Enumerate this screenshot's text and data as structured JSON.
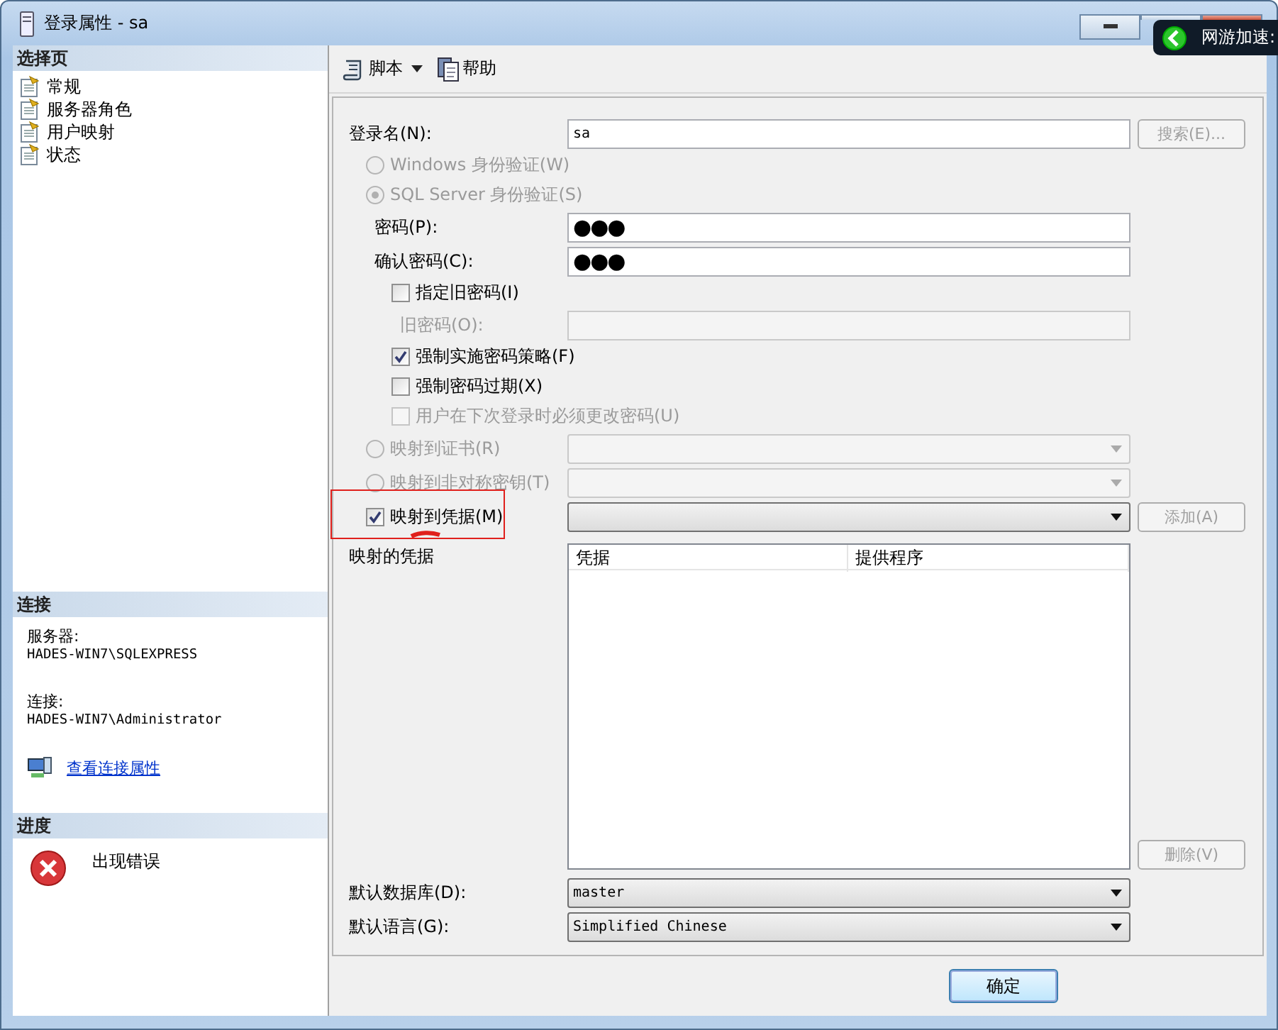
{
  "window": {
    "title": "登录属性 - sa"
  },
  "overlay": {
    "label": "网游加速:"
  },
  "sidebar": {
    "header": "选择页",
    "items": [
      {
        "label": "常规"
      },
      {
        "label": "服务器角色"
      },
      {
        "label": "用户映射"
      },
      {
        "label": "状态"
      }
    ]
  },
  "connection": {
    "header": "连接",
    "server_label": "服务器:",
    "server": "HADES-WIN7\\SQLEXPRESS",
    "user_label": "连接:",
    "user": "HADES-WIN7\\Administrator",
    "link": "查看连接属性"
  },
  "progress": {
    "header": "进度",
    "status": "出现错误"
  },
  "toolbar": [
    {
      "label": "脚本",
      "kind": "script"
    },
    {
      "label": "帮助",
      "kind": "help"
    }
  ],
  "form": [
    {
      "kind": "field",
      "label": "登录名(N):",
      "value": "sa",
      "disabled": false,
      "button": {
        "label": "搜索(E)...",
        "disabled": true
      }
    },
    {
      "kind": "radio",
      "label": "Windows 身份验证(W)",
      "selected": false,
      "disabled": true
    },
    {
      "kind": "radio",
      "label": "SQL Server 身份验证(S)",
      "selected": true,
      "disabled": true,
      "children": [
        {
          "kind": "field",
          "label": "密码(P):",
          "value": "●●●",
          "disabled": false
        },
        {
          "kind": "field",
          "label": "确认密码(C):",
          "value": "●●●",
          "disabled": false
        },
        {
          "kind": "checkbox",
          "label": "指定旧密码(I)",
          "checked": false,
          "disabled": false,
          "children": [
            {
              "kind": "field",
              "label": "旧密码(O):",
              "disabled": true
            }
          ]
        },
        {
          "kind": "checkbox",
          "label": "强制实施密码策略(F)",
          "checked": true,
          "disabled": false
        },
        {
          "kind": "checkbox",
          "label": "强制密码过期(X)",
          "checked": false,
          "disabled": false
        },
        {
          "kind": "checkbox",
          "label": "用户在下次登录时必须更改密码(U)",
          "checked": false,
          "disabled": true
        }
      ]
    },
    {
      "kind": "radio",
      "label": "映射到证书(R)",
      "selected": false,
      "disabled": true,
      "dropdown": {
        "disabled": true
      }
    },
    {
      "kind": "radio",
      "label": "映射到非对称密钥(T)",
      "selected": false,
      "disabled": true,
      "dropdown": {
        "disabled": true
      }
    },
    {
      "kind": "checkbox",
      "label": "映射到凭据(M)",
      "checked": true,
      "disabled": false,
      "highlighted": true,
      "dropdown": {
        "disabled": false
      },
      "button": {
        "label": "添加(A)",
        "disabled": true
      }
    },
    {
      "kind": "grid",
      "label": "映射的凭据",
      "columns": [
        "凭据",
        "提供程序"
      ],
      "button": {
        "label": "删除(V)",
        "disabled": true
      }
    },
    {
      "kind": "dropdown",
      "label": "默认数据库(D):",
      "value": "master",
      "disabled": false
    },
    {
      "kind": "dropdown",
      "label": "默认语言(G):",
      "value": "Simplified Chinese",
      "disabled": false
    }
  ],
  "footer": {
    "buttons": [
      "确定"
    ]
  }
}
